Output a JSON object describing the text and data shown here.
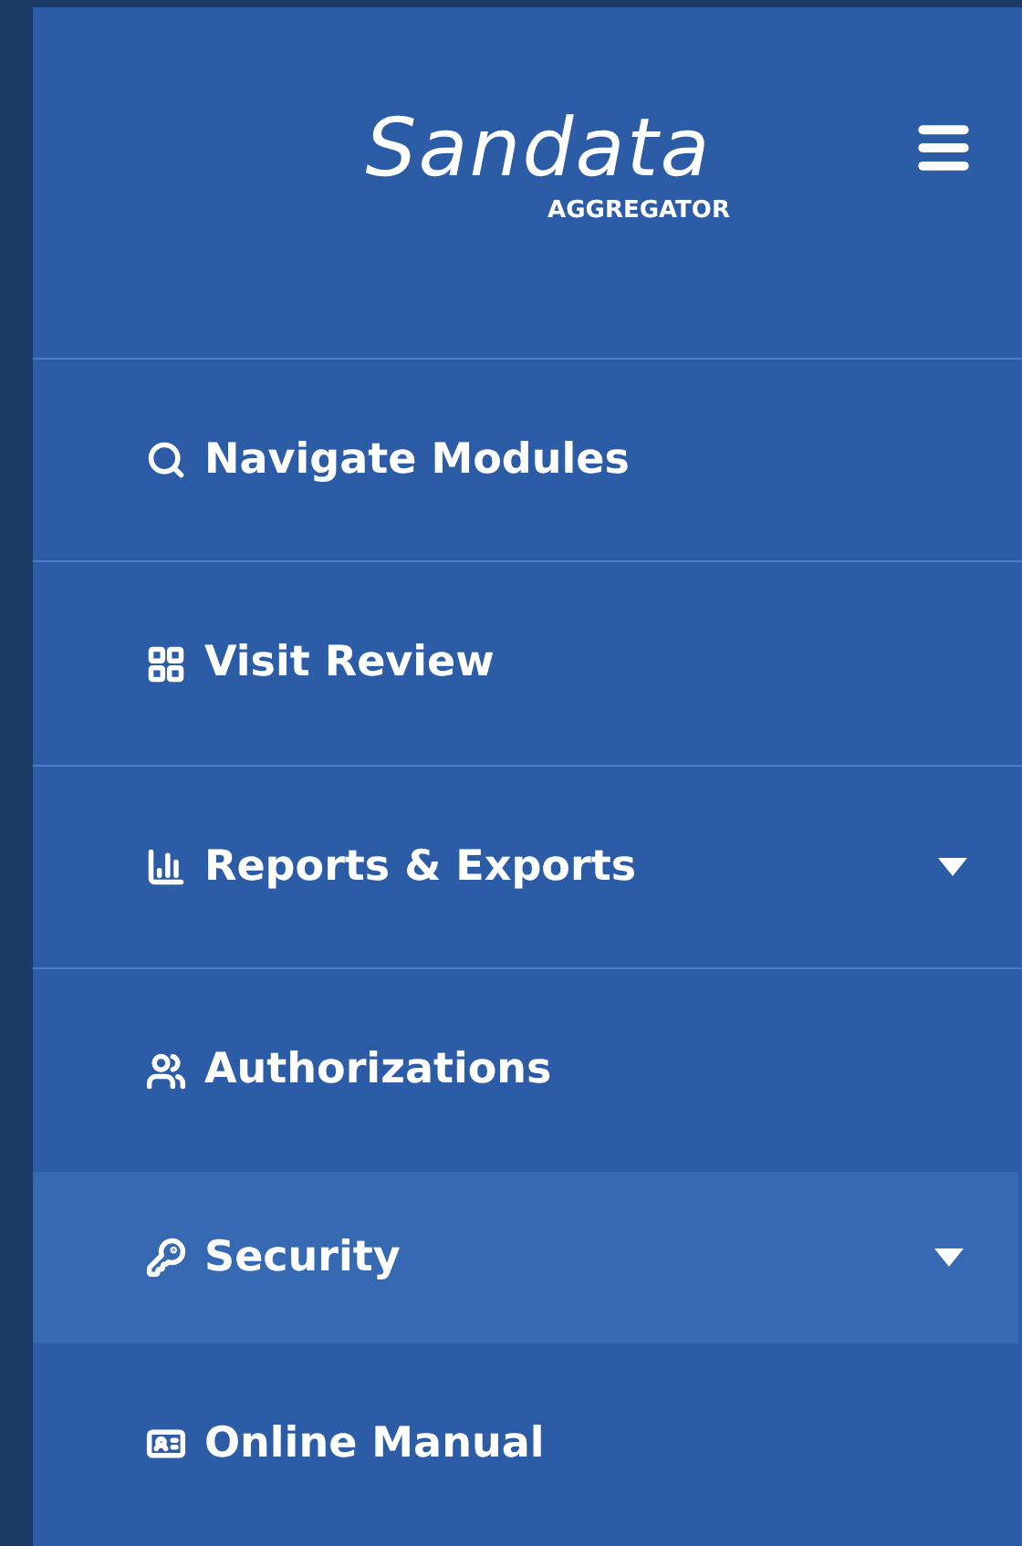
{
  "logo": {
    "name": "Sandata",
    "subtitle": "AGGREGATOR"
  },
  "menu": [
    {
      "kind": "search",
      "label": "Navigate Modules",
      "selected": false,
      "dropdown": false
    },
    {
      "kind": "grid",
      "label": "Visit Review",
      "selected": false,
      "dropdown": false
    },
    {
      "kind": "chart",
      "label": "Reports & Exports",
      "selected": false,
      "dropdown": true
    },
    {
      "kind": "users",
      "label": "Authorizations",
      "selected": false,
      "dropdown": false
    },
    {
      "kind": "key",
      "label": "Security",
      "selected": true,
      "dropdown": true
    },
    {
      "kind": "card",
      "label": "Online Manual",
      "selected": false,
      "dropdown": false
    }
  ]
}
